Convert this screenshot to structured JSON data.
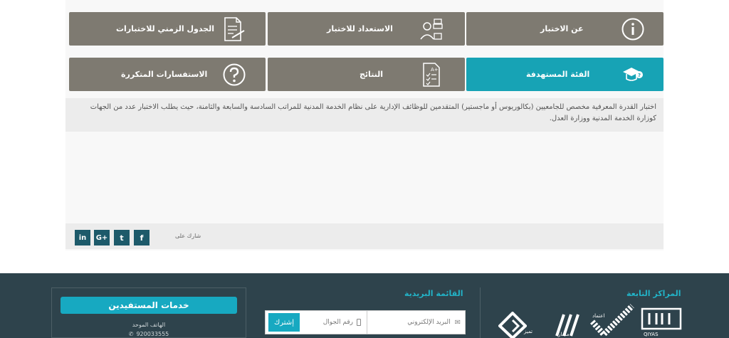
{
  "tiles": {
    "schedule": "الجدول الزمني للاختبارات",
    "prep": "الاستعداد للاختبار",
    "about": "عن الاختبار",
    "faq": "الاستفسارات المتكررة",
    "results": "النتائج",
    "target": "الفئة المستهدفة"
  },
  "description": "اختبار  القدرة المعرفية مخصص للجامعيين (بكالوريوس أو ماجستير) المتقدمين للوظائف الإدارية على نظام الخدمة المدنية للمراتب السادسة والسابعة والثامنة، حيث يطلب الاختبار عدد من الجهات كوزارة الخدمة المدنية ووزارة العدل.",
  "share": {
    "label": "شارك على",
    "buttons": [
      "f",
      "t",
      "G+",
      "in"
    ]
  },
  "footer": {
    "centers_heading": "المراكز التابعة",
    "mailing_heading": "القائمة البريدية",
    "email_placeholder": "البريد الإلكتروني",
    "mobile_placeholder": "رقم الجوال",
    "subscribe": "إشترك",
    "services_title": "خدمات المستفيدين",
    "unified_phone_label": "الهاتف الموحد",
    "phone": "920033555",
    "logos": [
      "QIYAS",
      "اعتماد",
      "مسار",
      "تميز"
    ]
  },
  "colors": {
    "tile_grey": "#7e7a71",
    "tile_active": "#17a3b5",
    "footer_bg": "#2e434c",
    "accent": "#22b3c7"
  }
}
